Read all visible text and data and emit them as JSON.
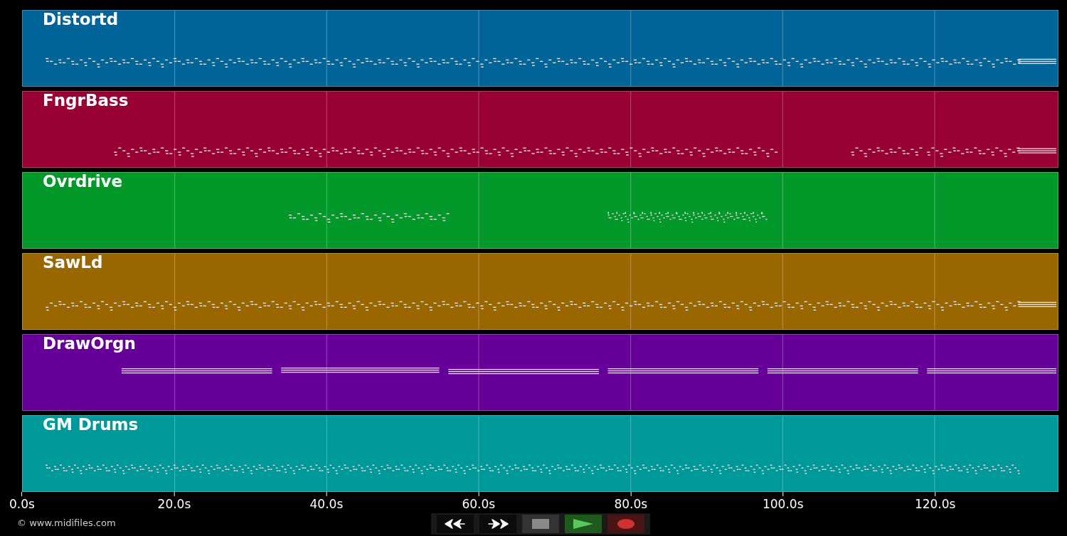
{
  "tracks": [
    {
      "name": "Distortd",
      "color": "#01659a"
    },
    {
      "name": "FngrBass",
      "color": "#990033"
    },
    {
      "name": "Ovrdrive",
      "color": "#02992a"
    },
    {
      "name": "SawLd",
      "color": "#996600"
    },
    {
      "name": "DrawOrgn",
      "color": "#660099"
    },
    {
      "name": "GM Drums",
      "color": "#009999"
    }
  ],
  "axis": {
    "ticks": [
      "0.0s",
      "20.0s",
      "40.0s",
      "60.0s",
      "80.0s",
      "100.0s",
      "120.0s"
    ]
  },
  "transport": [
    {
      "kind": "rewind"
    },
    {
      "kind": "forward"
    },
    {
      "kind": "stop"
    },
    {
      "kind": "play"
    },
    {
      "kind": "record"
    }
  ],
  "credit": "© www.midifiles.com"
}
